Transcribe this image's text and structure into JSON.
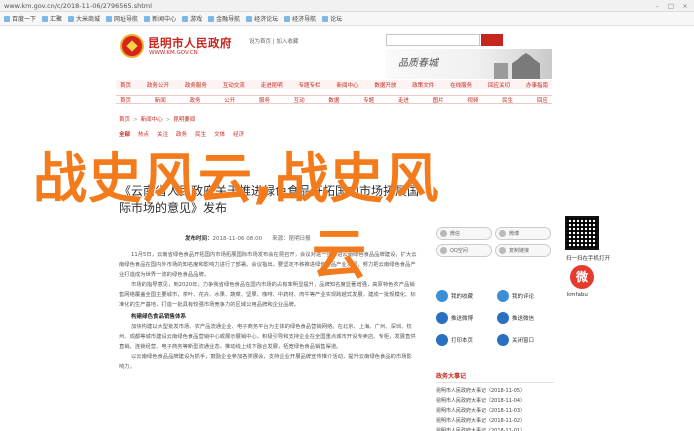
{
  "browser": {
    "url": "www.km.gov.cn/c/2018-11-06/2796565.shtml",
    "bookmarks": [
      "百度一下",
      "汇聚",
      "大米商城",
      "网址导航",
      "新闻中心",
      "游戏",
      "金融导航",
      "经济论坛",
      "经济导航",
      "论坛"
    ]
  },
  "header": {
    "title": "昆明市人民政府",
    "domain": "WWW.KM.GOV.CN",
    "links": "设为首页 | 加入收藏",
    "banner_script": "品质春城"
  },
  "nav": {
    "primary": [
      "首页",
      "政务公开",
      "政务服务",
      "互动交流",
      "走进昆明",
      "专题专栏",
      "新闻中心",
      "数据开放",
      "政策文件",
      "在线服务",
      "回应关切",
      "办事指南"
    ],
    "secondary": [
      "首页",
      "新闻",
      "政务",
      "公开",
      "服务",
      "互动",
      "数据",
      "专题",
      "走进",
      "图片",
      "视频",
      "民生",
      "回应"
    ]
  },
  "breadcrumb": [
    "首页",
    "新闻中心",
    "昆明要闻"
  ],
  "sub_nav": [
    "全部",
    "热点",
    "关注",
    "政务",
    "民生",
    "文体",
    "经济"
  ],
  "watermark": {
    "line1": "战史风云,战史风",
    "line2": "云"
  },
  "article": {
    "title": "《云南省人民政府关于推进绿色食品开拓国内市场拓展国际市场的意见》发布",
    "meta_source_label": "发布时间：",
    "meta_date": "2018-11-06 08:00",
    "meta_source": "来源：昆明日报",
    "paragraphs": [
      "11月5日，云南省绿色食品开拓国内市场拓展国际市场发布会在昆召开，会议对进一步推进云南绿色食品品牌建设，扩大云南绿色食品在国内外市场的知名度和影响力进行了部署。会议指出，要坚定不移推进绿色食品产业发展，努力把云南绿色食品产业打造成为世界一流的绿色食品品牌。",
      "市场的指导意见，到2020年，力争我省绿色食品在国内市场的占有率明显提升，品牌知名度显著增强，高原特色农产品销售网络覆盖全国主要城市，茶叶、花卉、水果、蔬菜、坚果、咖啡、中药材、肉牛等产业实现跨越式发展，建成一批规模化、标准化的生产基地，打造一批具有较强市场竞争力的区域公用品牌和企业品牌。"
    ],
    "section_heading": "构建绿色食品销售体系",
    "paragraphs2": [
      "加快构建以大型批发市场、农产品流通企业、电子商务平台为主体的绿色食品营销网络。在北京、上海、广州、深圳、杭州、成都等城市建设云南绿色食品营销中心或展示展销中心，积极引导和支持企业在全国重点城市开设专卖店、专柜，发展直供直销、连锁经营、电子商务等新型流通业态，推动线上线下融合发展，拓宽绿色食品销售渠道。",
      "以云南绿色食品品牌建设为抓手，鼓励企业参加各类展会，支持企业开展品牌宣传推介活动，提升云南绿色食品的市场影响力。"
    ]
  },
  "share": {
    "row1": [
      "微信",
      "微博"
    ],
    "row2": [
      "QQ空间",
      "复制链接"
    ]
  },
  "qr": {
    "label": "扫一扫在手机打开",
    "app_label": "kmfabu"
  },
  "actions": [
    {
      "label": "我的收藏",
      "color": "#3a8fd6"
    },
    {
      "label": "我的评论",
      "color": "#3a8fd6"
    },
    {
      "label": "推送微博",
      "color": "#2a6fc0"
    },
    {
      "label": "推送微信",
      "color": "#2a6fc0"
    },
    {
      "label": "打印本页",
      "color": "#2a6fc0"
    },
    {
      "label": "关闭窗口",
      "color": "#2a6fc0"
    }
  ],
  "related": {
    "heading": "政务大事记",
    "items": [
      "昆明市人民政府大事记（2018-11-05）",
      "昆明市人民政府大事记（2018-11-04）",
      "昆明市人民政府大事记（2018-11-03）",
      "昆明市人民政府大事记（2018-11-02）",
      "昆明市人民政府大事记（2018-11-01）",
      "昆明市人民政府大事记（2018-10-31）"
    ]
  },
  "colors": {
    "brand_red": "#c5261d",
    "watermark_orange": "#f47b1b"
  }
}
